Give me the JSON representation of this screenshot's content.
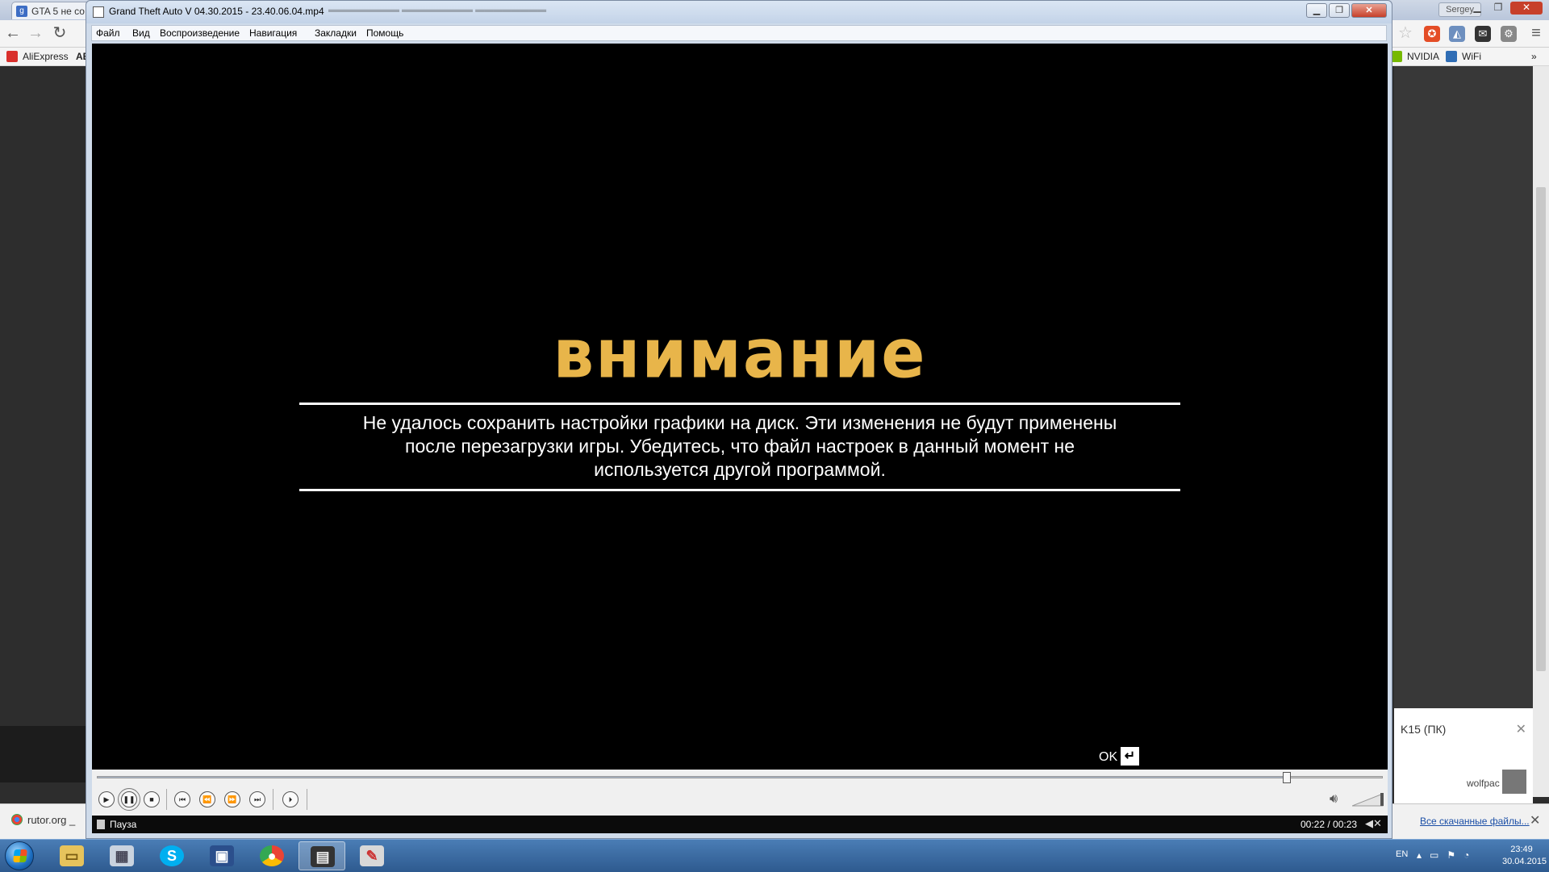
{
  "browser": {
    "tab_title": "GTA 5 не со",
    "user_name": "Sergey",
    "bookmarks": {
      "aliexpress": "AliExpress",
      "ae": "AE",
      "nvidia": "NVIDIA",
      "wifi": "WiFi"
    },
    "card": {
      "text": "K15 (ПК)",
      "user": "wolfpac"
    },
    "download": {
      "item": "rutor.org _",
      "show_all": "Все скачанные файлы..."
    }
  },
  "player": {
    "title": "Grand Theft Auto V 04.30.2015 - 23.40.06.04.mp4",
    "menu": [
      "Файл",
      "Вид",
      "Воспроизведение",
      "Навигация",
      "Закладки",
      "Помощь"
    ],
    "video": {
      "heading": "внимание",
      "message_lines": [
        "Не удалось сохранить настройки графики на диск. Эти изменения не будут применены",
        "после перезагрузки игры. Убедитесь, что файл настроек в данный момент не",
        "используется другой программой."
      ],
      "ok_label": "OK",
      "ok_key": "↵"
    },
    "seek_progress": 0.925,
    "status": {
      "state": "Пауза",
      "time": "00:22 / 00:23"
    }
  },
  "taskbar": {
    "lang": "EN",
    "time": "23:49",
    "date": "30.04.2015"
  },
  "colors": {
    "heading": "#e8b54a",
    "video_bg": "#000000",
    "taskbar": "#3a6ba3"
  }
}
